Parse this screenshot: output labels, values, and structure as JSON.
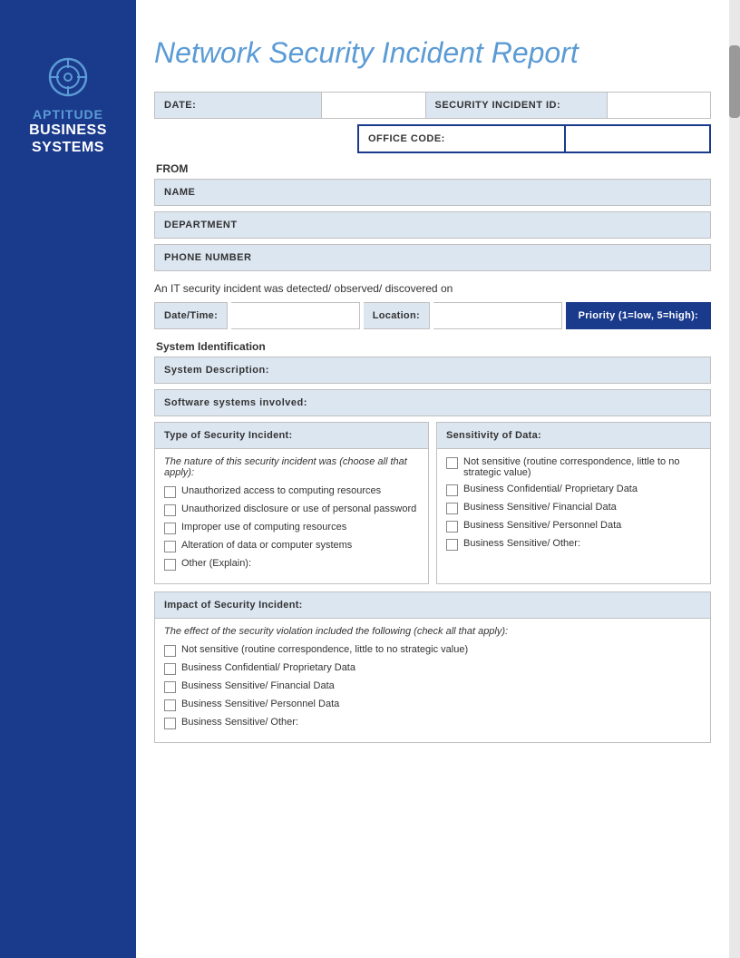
{
  "sidebar": {
    "icon_label": "target-icon",
    "brand_line1": "APTITUDE",
    "brand_line2": "BUSINESS",
    "brand_line3": "SYSTEMS"
  },
  "header": {
    "title": "Network Security Incident Report"
  },
  "form": {
    "date_label": "DATE:",
    "security_id_label": "SECURITY INCIDENT ID:",
    "office_code_label": "OFFICE CODE:",
    "from_label": "FROM",
    "name_label": "NAME",
    "department_label": "DEPARTMENT",
    "phone_label": "PHONE NUMBER",
    "detected_text": "An IT security incident was detected/ observed/ discovered on",
    "date_time_label": "Date/Time:",
    "location_label": "Location:",
    "priority_label": "Priority (1=low, 5=high):",
    "system_identification_label": "System Identification",
    "system_description_label": "System Description:",
    "software_systems_label": "Software systems involved:"
  },
  "type_of_incident": {
    "header": "Type of Security Incident:",
    "subtext": "The nature of this security incident was (choose all that apply):",
    "options": [
      "Unauthorized access to computing resources",
      "Unauthorized disclosure or use of personal password",
      "Improper use of computing resources",
      "Alteration of data or computer systems",
      "Other (Explain):"
    ]
  },
  "sensitivity": {
    "header": "Sensitivity of Data:",
    "options": [
      "Not sensitive (routine correspondence, little to no strategic value)",
      "Business Confidential/ Proprietary Data",
      "Business Sensitive/ Financial Data",
      "Business Sensitive/ Personnel Data",
      "Business Sensitive/ Other:"
    ]
  },
  "impact": {
    "header": "Impact of Security Incident:",
    "subtext": "The effect of the security violation included the following (check all that apply):",
    "options": [
      "Not sensitive (routine correspondence, little to no strategic value)",
      "Business Confidential/ Proprietary Data",
      "Business Sensitive/ Financial Data",
      "Business Sensitive/ Personnel Data",
      "Business Sensitive/ Other:"
    ]
  }
}
